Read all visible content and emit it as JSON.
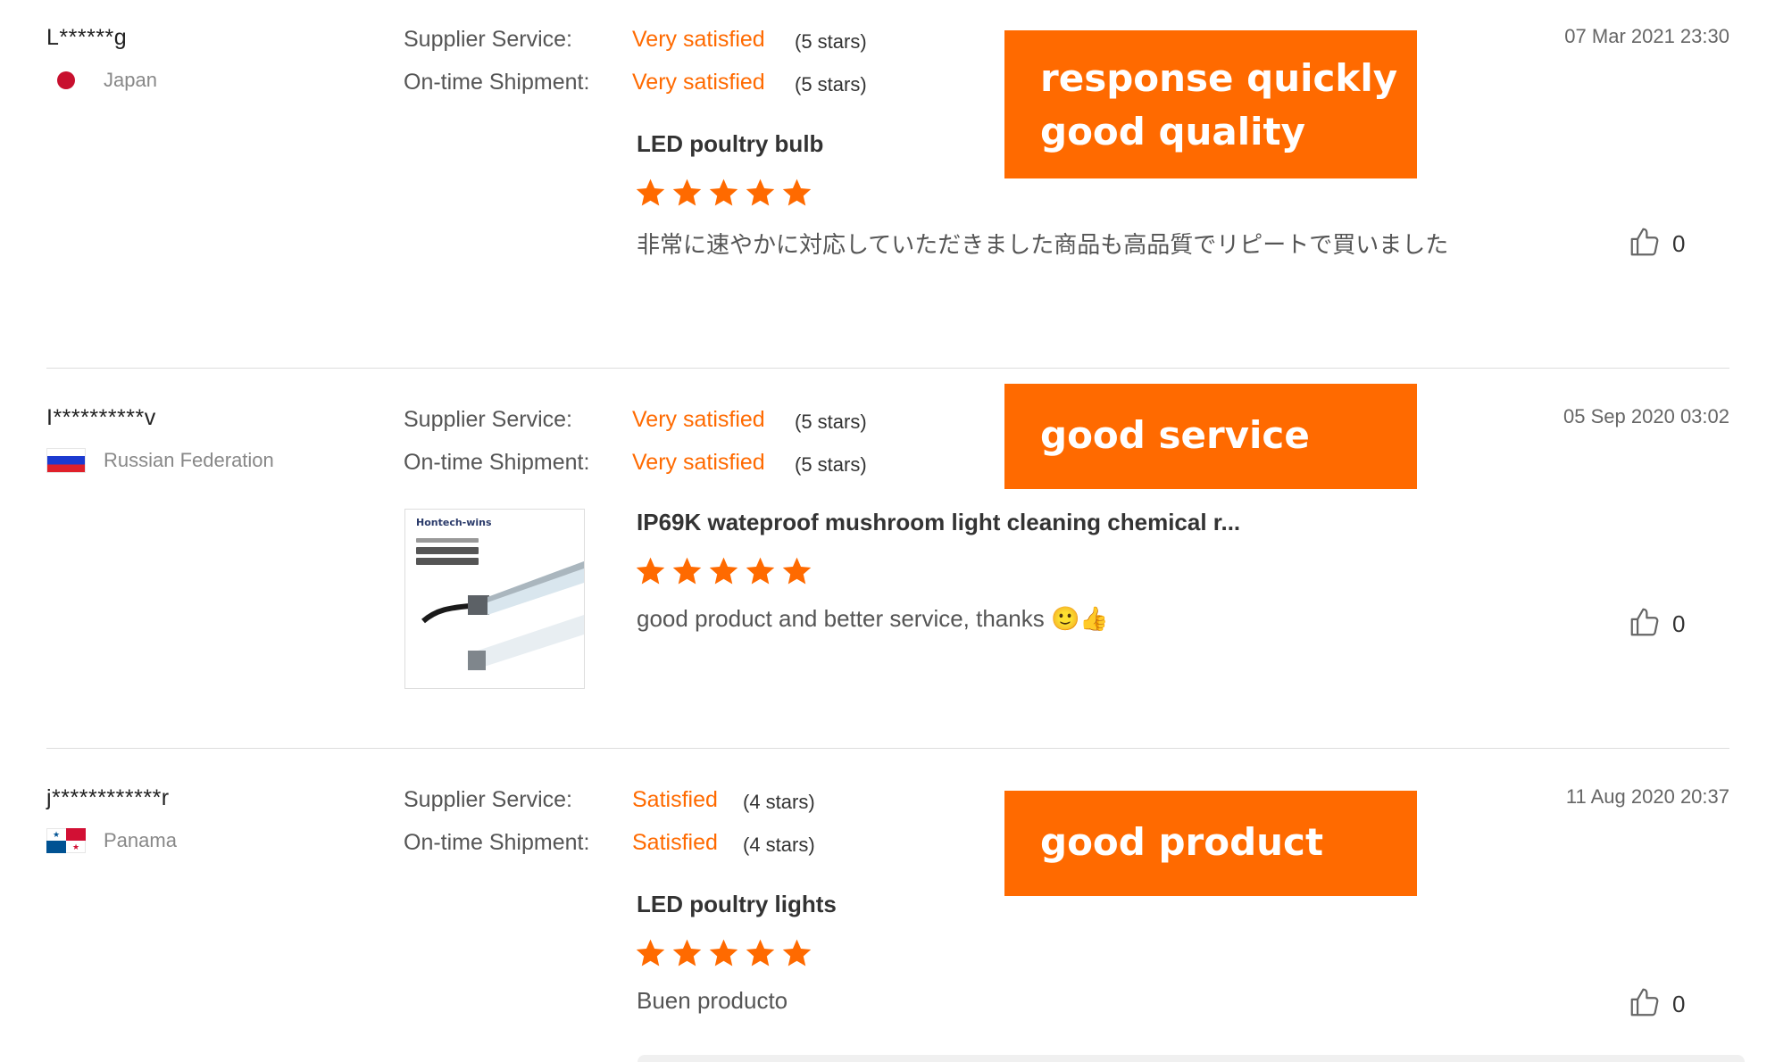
{
  "colors": {
    "accent": "#ff6a00",
    "divider": "#dcdcdc"
  },
  "reviews": [
    {
      "user": "L******g",
      "country": "Japan",
      "flag_icon": "japan-flag-icon",
      "supplier_label": "Supplier Service:",
      "supplier_value": "Very satisfied",
      "supplier_stars": "(5 stars)",
      "shipment_label": "On-time Shipment:",
      "shipment_value": "Very satisfied",
      "shipment_stars": "(5 stars)",
      "banner_line1": "response quickly",
      "banner_line2": "good quality",
      "date": "07 Mar 2021 23:30",
      "product": "LED poultry bulb",
      "product_rating": 5,
      "comment": "非常に速やかに対応していただきました商品も高品質でリピートで買いました",
      "likes": "0"
    },
    {
      "user": "I**********v",
      "country": "Russian Federation",
      "flag_icon": "russia-flag-icon",
      "supplier_label": "Supplier Service:",
      "supplier_value": "Very satisfied",
      "supplier_stars": "(5 stars)",
      "shipment_label": "On-time Shipment:",
      "shipment_value": "Very satisfied",
      "shipment_stars": "(5 stars)",
      "banner_line1": "good service",
      "date": "05 Sep 2020 03:02",
      "product": "IP69K wateproof mushroom light cleaning chemical r...",
      "product_image_brand": "Hontech-wins",
      "product_rating": 5,
      "comment": "good product and better service, thanks 🙂👍",
      "likes": "0"
    },
    {
      "user": "j************r",
      "country": "Panama",
      "flag_icon": "panama-flag-icon",
      "supplier_label": "Supplier Service:",
      "supplier_value": "Satisfied",
      "supplier_stars": "(4 stars)",
      "shipment_label": "On-time Shipment:",
      "shipment_value": "Satisfied",
      "shipment_stars": "(4 stars)",
      "banner_line1": "good product",
      "date": "11 Aug 2020 20:37",
      "product": "LED poultry lights",
      "product_rating": 5,
      "comment": "Buen producto",
      "likes": "0"
    }
  ]
}
